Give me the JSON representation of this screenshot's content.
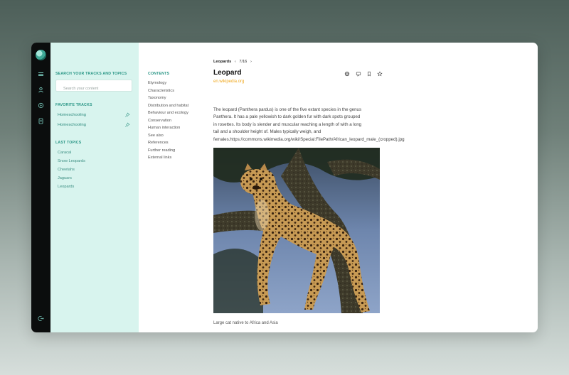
{
  "sidebar": {
    "search_heading": "SEARCH YOUR TRACKS AND TOPICS",
    "search_placeholder": "Search your content",
    "favorite_heading": "FAVORITE TRACKS",
    "favorites": [
      {
        "label": "Homeschooling"
      },
      {
        "label": "Homeschooling"
      }
    ],
    "last_heading": "LAST TOPICS",
    "topics": [
      "Caracal",
      "Snow Leopards",
      "Cheetahs",
      "Jaguars",
      "Leopards"
    ]
  },
  "toc": {
    "title": "CONTENTS",
    "items": [
      "Etymology",
      "Characteristics",
      "Taxonomy",
      "Distribution and habitat",
      "Behaviour and ecology",
      "Conservation",
      "Human interaction",
      "See also",
      "References",
      "Further reading",
      "External links"
    ]
  },
  "article": {
    "breadcrumb": "Leopards",
    "position": "7/16",
    "prev_glyph": "‹",
    "next_glyph": "›",
    "title": "Leopard",
    "source": "en.wikipedia.org",
    "paragraph_lines": [
      "The leopard (Panthera pardus) is one of the five extant species in the genus",
      "Panthera. It has a pale yellowish to dark golden fur with dark spots grouped",
      "in rosettes. Its body is slender and muscular reaching a length of with a long",
      "tail and a shoulder height of. Males typically weigh, and",
      "females.https://commons.wikimedia.org/wiki/Special:FilePath/African_leopard_male_(cropped).jpg"
    ],
    "caption": "Large cat native to Africa and Asia"
  },
  "icons": {
    "rail": [
      "menu-icon",
      "user-icon",
      "play-icon",
      "document-icon",
      "logout-icon"
    ],
    "toolbar": [
      "globe-icon",
      "comment-icon",
      "bookmark-icon",
      "star-icon"
    ]
  },
  "colors": {
    "accent": "#2a9686",
    "source_link": "#f0a81e",
    "sidebar_bg": "#d8f4ee",
    "rail_bg": "#0b0d0d"
  }
}
